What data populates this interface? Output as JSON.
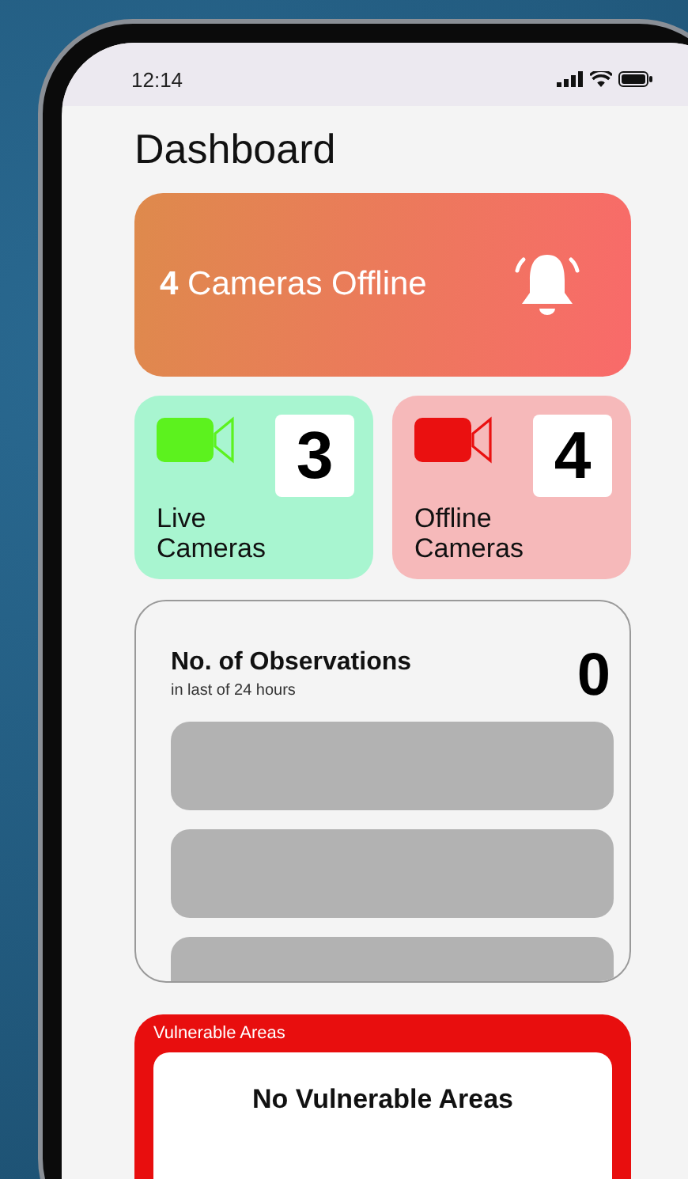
{
  "status_bar": {
    "time": "12:14"
  },
  "title": "Dashboard",
  "alert": {
    "count": "4",
    "text": "Cameras Offline"
  },
  "stat_cards": [
    {
      "kind": "live",
      "count": "3",
      "label_lines": [
        "Live",
        "Cameras"
      ]
    },
    {
      "kind": "offline",
      "count": "4",
      "label_lines": [
        "Offline",
        "Cameras"
      ]
    }
  ],
  "observations": {
    "title": "No. of Observations",
    "subtitle": "in last of 24 hours",
    "count": "0"
  },
  "vulnerable_areas": {
    "heading": "Vulnerable Areas",
    "message": "No Vulnerable Areas"
  }
}
